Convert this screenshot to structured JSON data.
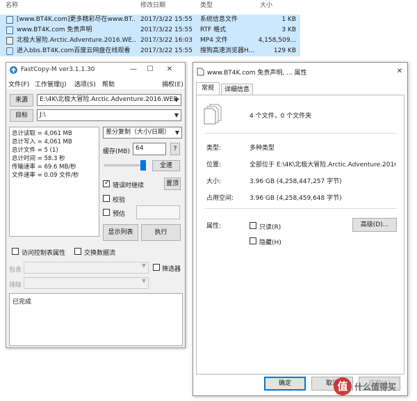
{
  "explorer": {
    "columns": {
      "name": "名称",
      "date": "修改日期",
      "type": "类型",
      "size": "大小"
    },
    "files": [
      {
        "name": "[www.BT4K.com]更多精彩尽在www.BT...",
        "date": "2017/3/22 15:55",
        "type": "系统信息文件",
        "size": "1 KB",
        "icon": "info-file-icon"
      },
      {
        "name": "www.BT4K.com 免责声明",
        "date": "2017/3/22 15:55",
        "type": "RTF 格式",
        "size": "3 KB",
        "icon": "rtf-file-icon"
      },
      {
        "name": "北极大冒险.Arctic.Adventure.2016.WE...",
        "date": "2017/3/22 16:03",
        "type": "MP4 文件",
        "size": "4,158,509...",
        "icon": "video-file-icon"
      },
      {
        "name": "进入bbs.BT4K.com百度云网盘在线观看",
        "date": "2017/3/22 15:55",
        "type": "搜狗高速浏览器H...",
        "size": "129 KB",
        "icon": "web-file-icon"
      }
    ]
  },
  "fastcopy": {
    "title": "FastCopy-M ver3.1.1.30",
    "menu": {
      "file": "文件(F)",
      "tasks": "工作管理(J)",
      "options": "选项(S)",
      "help": "帮助",
      "donate": "捐权(E)"
    },
    "source_label": "来源",
    "source_path": "E:\\4K\\北极大冒险.Arctic.Adventure.2016.WEB-",
    "dest_label": "目标",
    "dest_path": "J:\\",
    "stats": [
      "总计读取 = 4,061 MB",
      "总计写入 = 4,061 MB",
      "总计文件 = 5 (1)",
      "总计时间 = 58.3 秒",
      "传输速率 = 69.6 MB/秒",
      "文件速率 = 0.09 文件/秒"
    ],
    "mode": "差分复制（大小/日期）",
    "buffer_label": "缓存(MB)",
    "buffer_value": "64",
    "help_btn": "?",
    "speed_fraction": 1.0,
    "speed_label": "全速",
    "continue_on_error": "错误时继续",
    "continue_checked": true,
    "top_btn": "置顶",
    "verify": "校验",
    "estimate": "预估",
    "list_btn": "显示列表",
    "run_btn": "执行",
    "acl": "访问控制表属性",
    "streams": "交换数据流",
    "include_label": "包含",
    "exclude_label": "排除",
    "filter": "筛选器",
    "log": "已完成"
  },
  "props": {
    "title": "www.BT4K.com 免责声明, ... 属性",
    "tabs": [
      "常规",
      "详细信息"
    ],
    "summary": "4 个文件，0 个文件夹",
    "rows": [
      {
        "label": "类型:",
        "value": "多种类型"
      },
      {
        "label": "位置:",
        "value": "全部位于 E:\\4K\\北极大冒险.Arctic.Adventure.2016.W"
      },
      {
        "label": "大小:",
        "value": "3.96 GB (4,258,447,257 字节)"
      },
      {
        "label": "占用空间:",
        "value": "3.96 GB (4,258,459,648 字节)"
      }
    ],
    "attr_label": "属性:",
    "readonly": "只读(R)",
    "hidden": "隐藏(H)",
    "advanced": "高级(D)...",
    "ok": "确定",
    "cancel": "取消",
    "apply": "应用(A)"
  },
  "watermark": {
    "badge": "值",
    "text": "什么值得买"
  }
}
